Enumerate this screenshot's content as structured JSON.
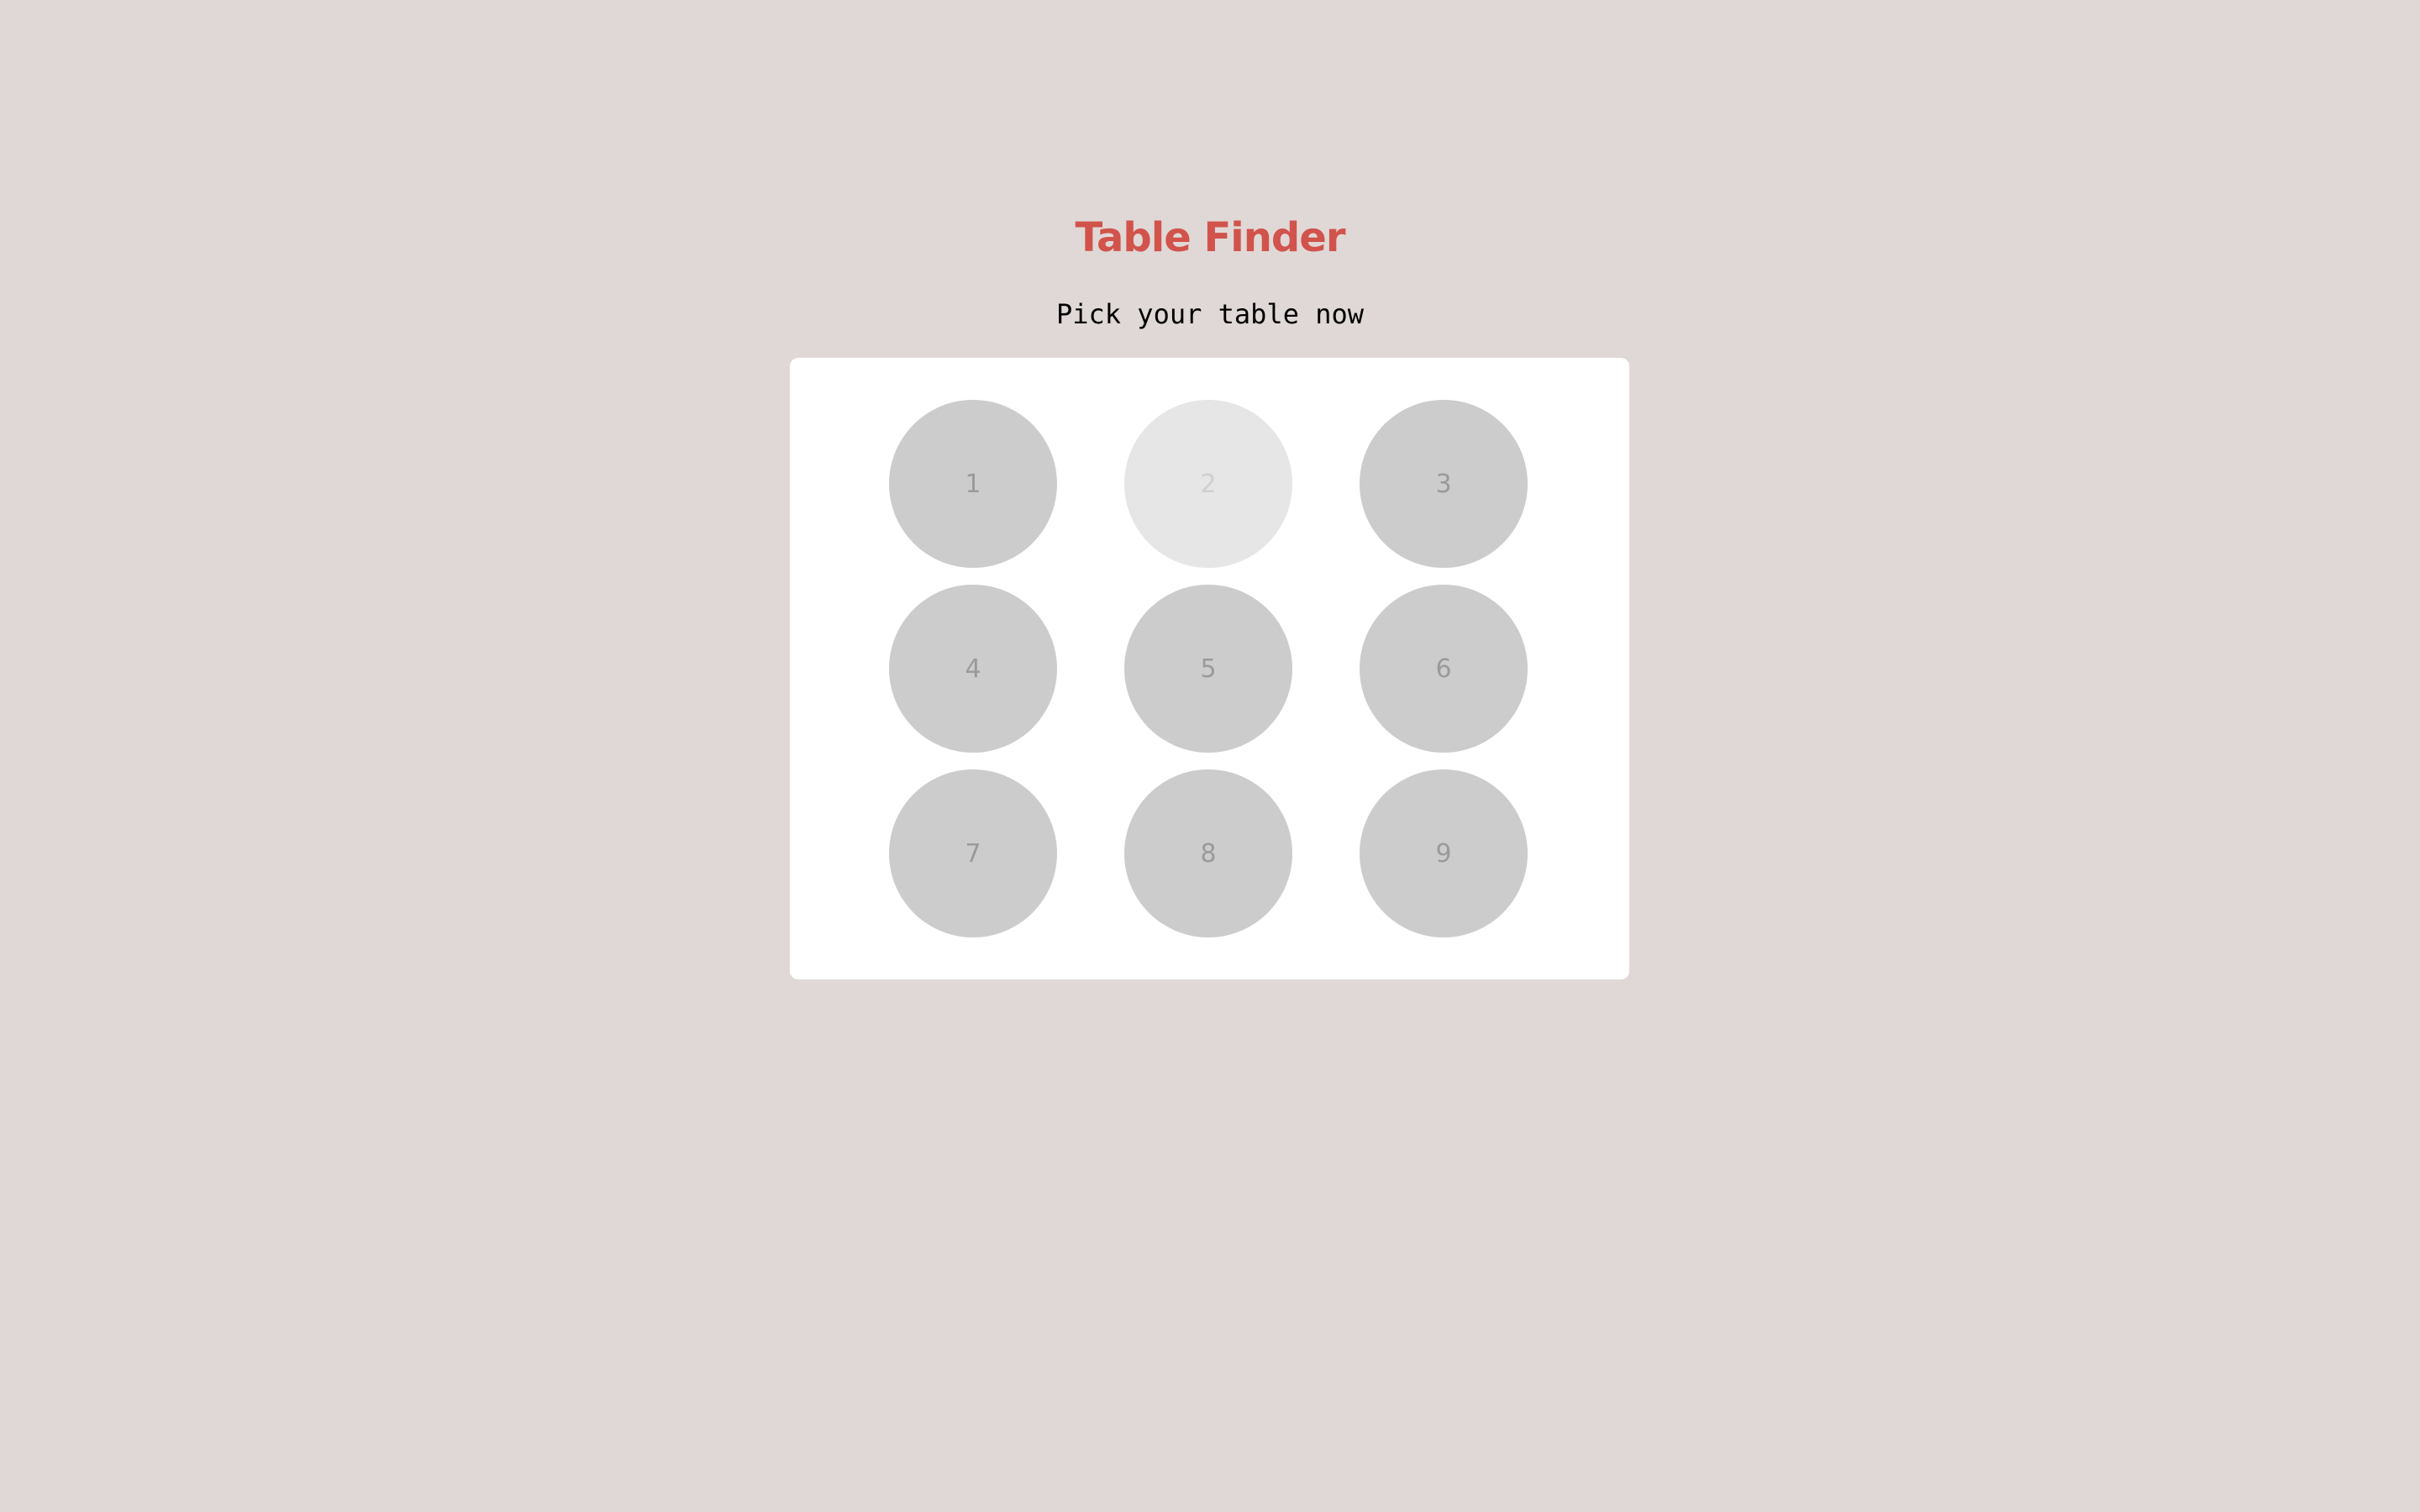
{
  "header": {
    "title": "Table Finder",
    "subtitle": "Pick your table now"
  },
  "colors": {
    "background": "#e0d8d6",
    "title": "#d1534b",
    "panel": "#ffffff",
    "table_available_bg": "#cccccc",
    "table_available_text": "#9a9a9a",
    "table_unavailable_bg": "#e6e6e6",
    "table_unavailable_text": "#cfcfcf"
  },
  "tables": [
    {
      "label": "1",
      "state": "available"
    },
    {
      "label": "2",
      "state": "unavailable"
    },
    {
      "label": "3",
      "state": "available"
    },
    {
      "label": "4",
      "state": "available"
    },
    {
      "label": "5",
      "state": "available"
    },
    {
      "label": "6",
      "state": "available"
    },
    {
      "label": "7",
      "state": "available"
    },
    {
      "label": "8",
      "state": "available"
    },
    {
      "label": "9",
      "state": "available"
    }
  ]
}
